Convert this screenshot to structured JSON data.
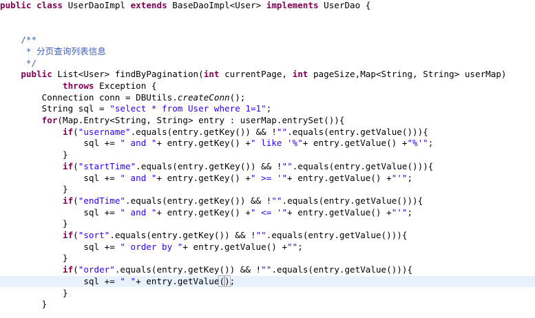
{
  "editor": {
    "lines": [
      {
        "tokens": [
          {
            "t": "public",
            "c": "kw"
          },
          {
            "t": " "
          },
          {
            "t": "class",
            "c": "kw"
          },
          {
            "t": " UserDaoImpl "
          },
          {
            "t": "extends",
            "c": "kw"
          },
          {
            "t": " BaseDaoImpl<User> "
          },
          {
            "t": "implements",
            "c": "kw"
          },
          {
            "t": " UserDao {"
          }
        ]
      },
      {
        "tokens": []
      },
      {
        "tokens": []
      },
      {
        "tokens": [
          {
            "t": "    /**",
            "c": "cm"
          }
        ]
      },
      {
        "tokens": [
          {
            "t": "     * ",
            "c": "cm"
          },
          {
            "t": "分页查询列表信息",
            "c": "cm cjk"
          }
        ]
      },
      {
        "tokens": [
          {
            "t": "     */",
            "c": "cm"
          }
        ]
      },
      {
        "tokens": [
          {
            "t": "    "
          },
          {
            "t": "public",
            "c": "kw"
          },
          {
            "t": " List<User> findByPagination("
          },
          {
            "t": "int",
            "c": "kw"
          },
          {
            "t": " currentPage, "
          },
          {
            "t": "int",
            "c": "kw"
          },
          {
            "t": " pageSize,Map<String, String> userMap)"
          }
        ]
      },
      {
        "tokens": [
          {
            "t": "            "
          },
          {
            "t": "throws",
            "c": "kw"
          },
          {
            "t": " Exception {"
          }
        ]
      },
      {
        "tokens": [
          {
            "t": "        Connection conn = DBUtils."
          },
          {
            "t": "createConn",
            "c": "it"
          },
          {
            "t": "();"
          }
        ]
      },
      {
        "tokens": [
          {
            "t": "        String sql = "
          },
          {
            "t": "\"select * from User where 1=1\"",
            "c": "str"
          },
          {
            "t": ";"
          }
        ]
      },
      {
        "tokens": [
          {
            "t": "        "
          },
          {
            "t": "for",
            "c": "kw"
          },
          {
            "t": "(Map.Entry<String, String> entry : userMap.entrySet()){"
          }
        ]
      },
      {
        "tokens": [
          {
            "t": "            "
          },
          {
            "t": "if",
            "c": "kw"
          },
          {
            "t": "("
          },
          {
            "t": "\"username\"",
            "c": "str"
          },
          {
            "t": ".equals(entry.getKey()) && !"
          },
          {
            "t": "\"\"",
            "c": "str"
          },
          {
            "t": ".equals(entry.getValue())){"
          }
        ]
      },
      {
        "tokens": [
          {
            "t": "                sql += "
          },
          {
            "t": "\" and \"",
            "c": "str"
          },
          {
            "t": "+ entry.getKey() +"
          },
          {
            "t": "\" like '%\"",
            "c": "str"
          },
          {
            "t": "+ entry.getValue() +"
          },
          {
            "t": "\"%'\"",
            "c": "str"
          },
          {
            "t": ";"
          }
        ]
      },
      {
        "tokens": [
          {
            "t": "            }"
          }
        ]
      },
      {
        "tokens": [
          {
            "t": "            "
          },
          {
            "t": "if",
            "c": "kw"
          },
          {
            "t": "("
          },
          {
            "t": "\"startTime\"",
            "c": "str"
          },
          {
            "t": ".equals(entry.getKey()) && !"
          },
          {
            "t": "\"\"",
            "c": "str"
          },
          {
            "t": ".equals(entry.getValue())){"
          }
        ]
      },
      {
        "tokens": [
          {
            "t": "                sql += "
          },
          {
            "t": "\" and \"",
            "c": "str"
          },
          {
            "t": "+ entry.getKey() +"
          },
          {
            "t": "\" >= '\"",
            "c": "str"
          },
          {
            "t": "+ entry.getValue() +"
          },
          {
            "t": "\"'\"",
            "c": "str"
          },
          {
            "t": ";"
          }
        ]
      },
      {
        "tokens": [
          {
            "t": "            }"
          }
        ]
      },
      {
        "tokens": [
          {
            "t": "            "
          },
          {
            "t": "if",
            "c": "kw"
          },
          {
            "t": "("
          },
          {
            "t": "\"endTime\"",
            "c": "str"
          },
          {
            "t": ".equals(entry.getKey()) && !"
          },
          {
            "t": "\"\"",
            "c": "str"
          },
          {
            "t": ".equals(entry.getValue())){"
          }
        ]
      },
      {
        "tokens": [
          {
            "t": "                sql += "
          },
          {
            "t": "\" and \"",
            "c": "str"
          },
          {
            "t": "+ entry.getKey() +"
          },
          {
            "t": "\" <= '\"",
            "c": "str"
          },
          {
            "t": "+ entry.getValue() +"
          },
          {
            "t": "\"'\"",
            "c": "str"
          },
          {
            "t": ";"
          }
        ]
      },
      {
        "tokens": [
          {
            "t": "            }"
          }
        ]
      },
      {
        "tokens": [
          {
            "t": "            "
          },
          {
            "t": "if",
            "c": "kw"
          },
          {
            "t": "("
          },
          {
            "t": "\"sort\"",
            "c": "str"
          },
          {
            "t": ".equals(entry.getKey()) && !"
          },
          {
            "t": "\"\"",
            "c": "str"
          },
          {
            "t": ".equals(entry.getValue())){"
          }
        ]
      },
      {
        "tokens": [
          {
            "t": "                sql += "
          },
          {
            "t": "\" order by \"",
            "c": "str"
          },
          {
            "t": "+ entry.getValue() +"
          },
          {
            "t": "\"\"",
            "c": "str"
          },
          {
            "t": ";"
          }
        ]
      },
      {
        "tokens": [
          {
            "t": "            }"
          }
        ]
      },
      {
        "tokens": [
          {
            "t": "            "
          },
          {
            "t": "if",
            "c": "kw"
          },
          {
            "t": "("
          },
          {
            "t": "\"order\"",
            "c": "str"
          },
          {
            "t": ".equals(entry.getKey()) && !"
          },
          {
            "t": "\"\"",
            "c": "str"
          },
          {
            "t": ".equals(entry.getValue())){"
          }
        ]
      },
      {
        "tokens": [
          {
            "t": "                sql += "
          },
          {
            "t": "\" \"",
            "c": "str"
          },
          {
            "t": "+ entry.getValue"
          },
          {
            "t": "(",
            "c": "paren-match"
          },
          {
            "caret": true
          },
          {
            "t": ")",
            "c": "paren-match"
          },
          {
            "t": ";"
          }
        ]
      },
      {
        "tokens": [
          {
            "t": "            }"
          }
        ]
      },
      {
        "tokens": [
          {
            "t": "        }"
          }
        ]
      }
    ]
  }
}
